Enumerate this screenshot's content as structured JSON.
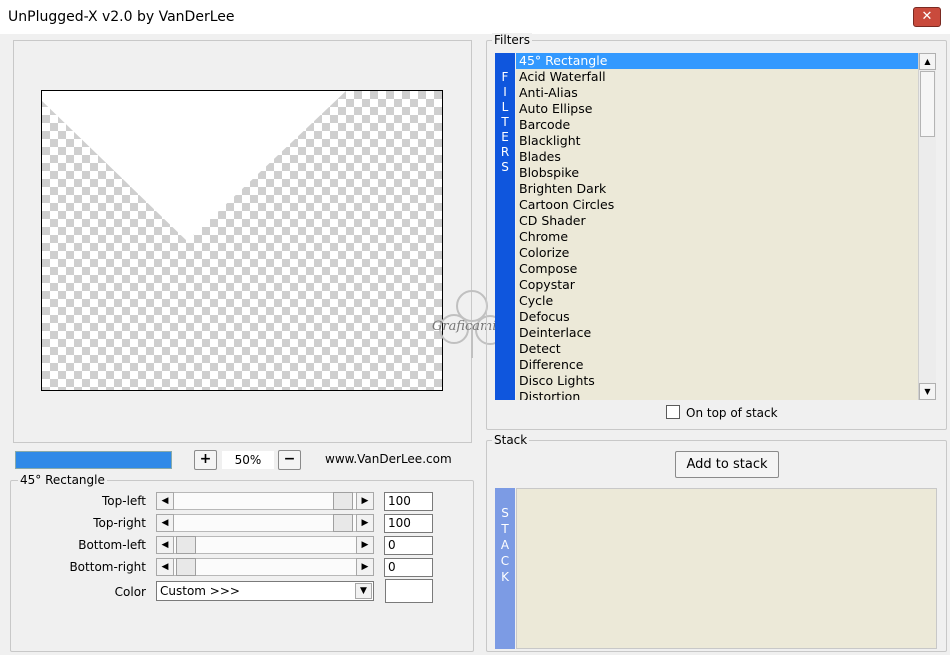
{
  "window": {
    "title": "UnPlugged-X v2.0 by VanDerLee",
    "close_label": "✕"
  },
  "preview": {
    "zoom_plus": "+",
    "zoom_level": "50%",
    "zoom_minus": "−",
    "url": "www.VanDerLee.com"
  },
  "params": {
    "group_title": "45° Rectangle",
    "top_left": {
      "label": "Top-left",
      "value": "100"
    },
    "top_right": {
      "label": "Top-right",
      "value": "100"
    },
    "bottom_left": {
      "label": "Bottom-left",
      "value": "0"
    },
    "bottom_right": {
      "label": "Bottom-right",
      "value": "0"
    },
    "color": {
      "label": "Color",
      "value": "Custom >>>",
      "swatch": "#ffffff"
    }
  },
  "filters": {
    "group_title": "Filters",
    "strip_letters": [
      "F",
      "I",
      "L",
      "T",
      "E",
      "R",
      "S"
    ],
    "selected": "45° Rectangle",
    "items": [
      "45° Rectangle",
      "Acid Waterfall",
      "Anti-Alias",
      "Auto Ellipse",
      "Barcode",
      "Blacklight",
      "Blades",
      "Blobspike",
      "Brighten Dark",
      "Cartoon Circles",
      "CD Shader",
      "Chrome",
      "Colorize",
      "Compose",
      "Copystar",
      "Cycle",
      "Defocus",
      "Deinterlace",
      "Detect",
      "Difference",
      "Disco Lights",
      "Distortion"
    ],
    "on_top_label": "On top of stack"
  },
  "stack": {
    "group_title": "Stack",
    "add_button": "Add to stack",
    "strip_letters": [
      "S",
      "T",
      "A",
      "C",
      "K"
    ]
  },
  "colors": {
    "selection": "#3399ff",
    "filter_strip": "#0f56dd",
    "stack_strip": "#7c9be4",
    "progress": "#2f8ae8",
    "list_bg": "#ece9d8"
  }
}
